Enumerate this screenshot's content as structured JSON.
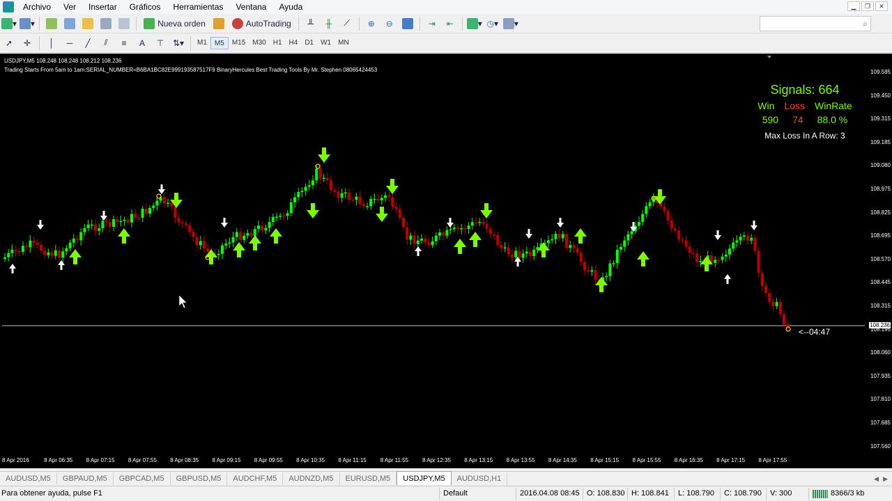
{
  "menu": [
    "Archivo",
    "Ver",
    "Insertar",
    "Gráficos",
    "Herramientas",
    "Ventana",
    "Ayuda"
  ],
  "toolbar": {
    "new_order": "Nueva orden",
    "autotrading": "AutoTrading"
  },
  "timeframes": [
    "M1",
    "M5",
    "M15",
    "M30",
    "H1",
    "H4",
    "D1",
    "W1",
    "MN"
  ],
  "active_timeframe": "M5",
  "chart": {
    "header": "USDJPY,M5  108.248 108.248 108.212 108.236",
    "indicator_line": "Trading Starts From 5am to 1am:SERIAL_NUMBER=B6BA1BC82E999193587517F9 BinaryHercules Best Trading Tools By Mr. Stephen 08065424453",
    "current_price": "108.236",
    "countdown": "<--04:47",
    "price_labels": [
      "109.585",
      "109.450",
      "109.315",
      "109.185",
      "109.080",
      "108.975",
      "108.825",
      "108.695",
      "108.570",
      "108.445",
      "108.315",
      "108.195",
      "108.060",
      "107.935",
      "107.810",
      "107.685",
      "107.560"
    ],
    "time_labels": [
      "8 Apr 2016",
      "8 Apr 06:35",
      "8 Apr 07:15",
      "8 Apr 07:55",
      "8 Apr 08:35",
      "8 Apr 09:15",
      "8 Apr 09:55",
      "8 Apr 10:35",
      "8 Apr 11:15",
      "8 Apr 11:55",
      "8 Apr 12:35",
      "8 Apr 13:15",
      "8 Apr 13:55",
      "8 Apr 14:35",
      "8 Apr 15:15",
      "8 Apr 15:55",
      "8 Apr 16:35",
      "8 Apr 17:15",
      "8 Apr 17:55"
    ],
    "colors": {
      "bull": "#00ff00",
      "bear": "#c00000",
      "signal_green": "#7cfc00",
      "loss_red": "#ff4040"
    }
  },
  "signals": {
    "title": "Signals: 664",
    "headers": [
      "Win",
      "Loss",
      "WinRate"
    ],
    "values": [
      "590",
      "74",
      "88.0 %"
    ],
    "max_loss": "Max Loss In A Row: 3"
  },
  "tabs": [
    "AUDUSD,M5",
    "GBPAUD,M5",
    "GBPCAD,M5",
    "GBPUSD,M5",
    "AUDCHF,M5",
    "AUDNZD,M5",
    "EURUSD,M5",
    "USDJPY,M5",
    "AUDUSD,H1"
  ],
  "active_tab": "USDJPY,M5",
  "status": {
    "help": "Para obtener ayuda, pulse F1",
    "profile": "Default",
    "datetime": "2016.04.08 08:45",
    "open": "O: 108.830",
    "high": "H: 108.841",
    "low": "L: 108.790",
    "close": "C: 108.790",
    "volume": "V: 300",
    "traffic": "8366/3 kb"
  }
}
